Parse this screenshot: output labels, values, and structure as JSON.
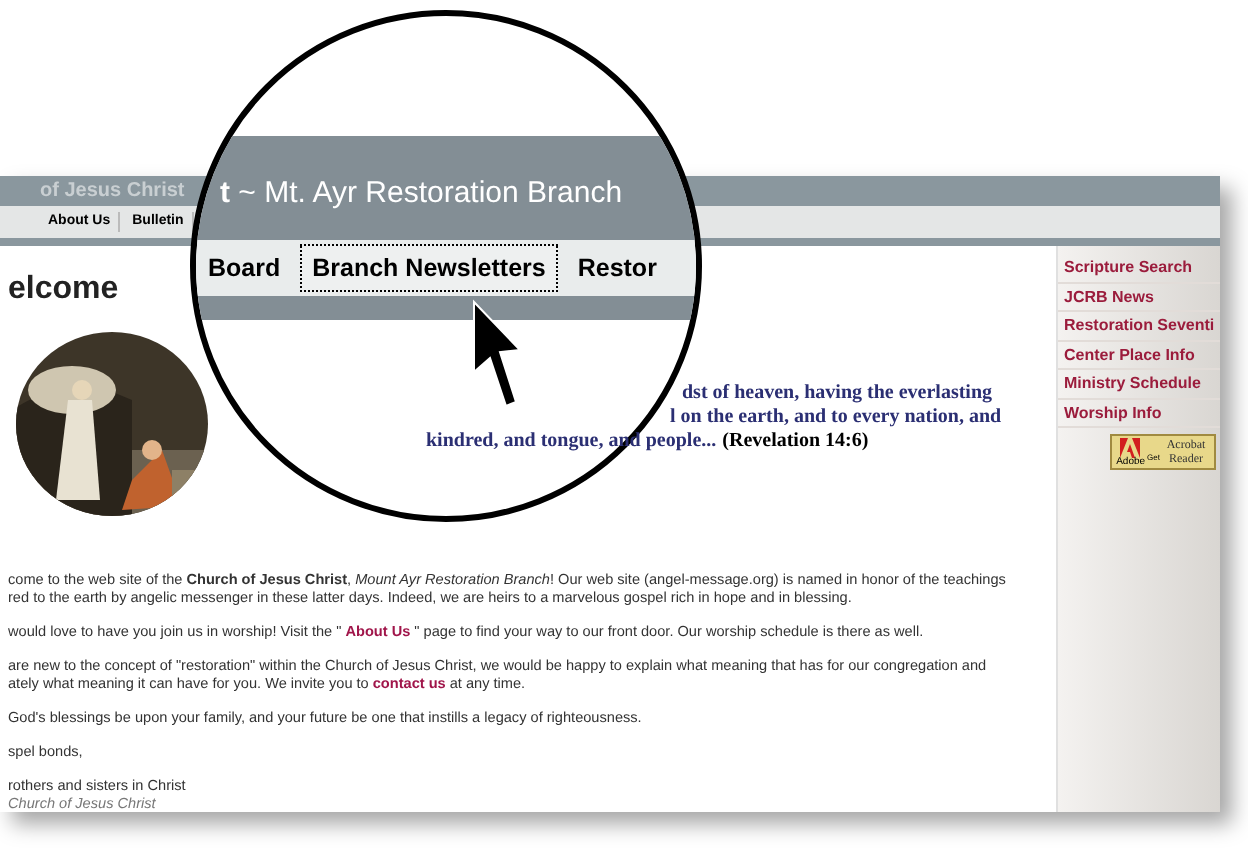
{
  "site_header": {
    "title": "of Jesus Christ",
    "nav": [
      {
        "label": "About Us",
        "selected": false
      },
      {
        "label": "Bulletin",
        "selected": false
      }
    ]
  },
  "heading": "elcome",
  "verse": {
    "lines": [
      [
        {
          "kind": "verse",
          "text": "dst of heaven, having the everlasting"
        }
      ],
      [
        {
          "kind": "verse",
          "text": "l on the earth, and to every nation, and"
        }
      ],
      [
        {
          "kind": "verse",
          "text": "kindred, and tongue, and people..."
        },
        {
          "kind": "reference",
          "text": "(Revelation 14:6)"
        }
      ]
    ]
  },
  "body": [
    [
      [
        {
          "kind": "text",
          "text": "come to the web site of the **Church of Jesus Christ**, *Mount Ayr Restoration Branch*! Our web site (angel-message.org) is named in honor of the teachings"
        }
      ],
      [
        {
          "kind": "text",
          "text": "red to the earth by angelic messenger in these latter days. Indeed, we are heirs to a marvelous gospel rich in hope and in blessing."
        }
      ]
    ],
    [
      [
        {
          "kind": "text",
          "text": "would love to have you join us in worship! Visit the \""
        },
        {
          "kind": "link",
          "text": "About Us"
        },
        {
          "kind": "text",
          "text": "\" page to find your way to our front door. Our worship schedule is there as well."
        }
      ]
    ],
    [
      [
        {
          "kind": "text",
          "text": "are new to the concept of \"restoration\" within the Church of Jesus Christ, we would be happy to explain what meaning that has for our congregation and"
        }
      ],
      [
        {
          "kind": "text",
          "text": "ately what meaning it can have for you. We invite you to"
        },
        {
          "kind": "link",
          "text": "contact us"
        },
        {
          "kind": "text",
          "text": "at any time."
        }
      ]
    ],
    [
      [
        {
          "kind": "text",
          "text": "God's blessings be upon your family, and your future be one that instills a legacy of righteousness."
        }
      ]
    ],
    [
      [
        {
          "kind": "text",
          "text": "spel bonds,"
        }
      ]
    ],
    [
      [
        {
          "kind": "text",
          "text": "rothers and sisters in Christ"
        }
      ],
      [
        {
          "kind": "signature",
          "text": "Church of Jesus Christ"
        }
      ]
    ]
  ],
  "sidebar": {
    "links": [
      "Scripture Search",
      "JCRB News",
      "Restoration Seventi",
      "Center Place Info",
      "Ministry Schedule",
      "Worship Info"
    ],
    "badge": {
      "brand": "Adobe",
      "get": "Get",
      "product": "Acrobat Reader"
    }
  },
  "magnifier": {
    "title": "**t** ~ Mt. Ayr Restoration Branch",
    "nav": [
      {
        "label": "Board",
        "selected": false
      },
      {
        "label": "Branch Newsletters",
        "selected": true
      },
      {
        "label": "Restor",
        "selected": false
      }
    ]
  }
}
